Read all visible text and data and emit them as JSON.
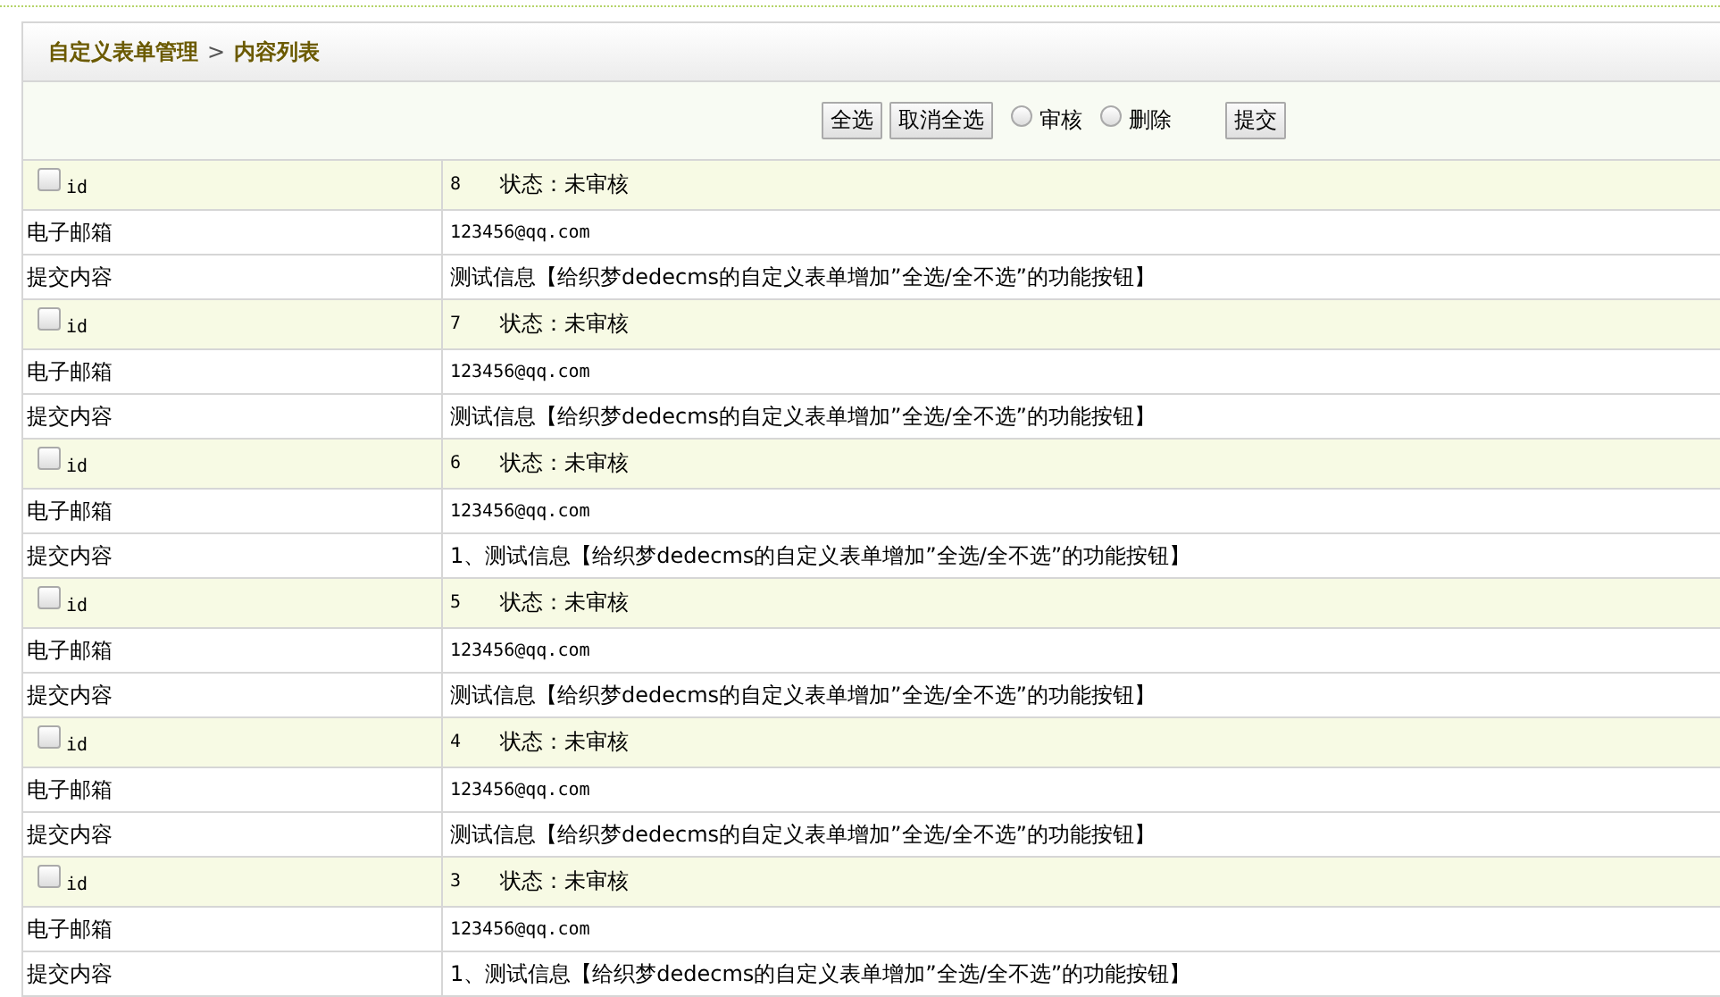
{
  "breadcrumb": {
    "root": "自定义表单管理",
    "separator": ">",
    "current": "内容列表"
  },
  "toolbar": {
    "buttons": [
      "全选",
      "取消全选"
    ],
    "radios": [
      {
        "label": "审核",
        "selected": false
      },
      {
        "label": "删除",
        "selected": false
      }
    ],
    "submit": "提交"
  },
  "records": [
    {
      "id_label": "id",
      "checked": false,
      "id": "8",
      "status": "状态：未审核",
      "fields": [
        {
          "label": "电子邮箱",
          "value": "123456@qq.com",
          "kind": "mono"
        },
        {
          "label": "提交内容",
          "value": "测试信息【给织梦dedecms的自定义表单增加”全选/全不选”的功能按钮】",
          "kind": "text"
        }
      ]
    },
    {
      "id_label": "id",
      "checked": false,
      "id": "7",
      "status": "状态：未审核",
      "fields": [
        {
          "label": "电子邮箱",
          "value": "123456@qq.com",
          "kind": "mono"
        },
        {
          "label": "提交内容",
          "value": "测试信息【给织梦dedecms的自定义表单增加”全选/全不选”的功能按钮】",
          "kind": "text"
        }
      ]
    },
    {
      "id_label": "id",
      "checked": false,
      "id": "6",
      "status": "状态：未审核",
      "fields": [
        {
          "label": "电子邮箱",
          "value": "123456@qq.com",
          "kind": "mono"
        },
        {
          "label": "提交内容",
          "value": "1、测试信息【给织梦dedecms的自定义表单增加”全选/全不选”的功能按钮】",
          "kind": "text"
        }
      ]
    },
    {
      "id_label": "id",
      "checked": false,
      "id": "5",
      "status": "状态：未审核",
      "fields": [
        {
          "label": "电子邮箱",
          "value": "123456@qq.com",
          "kind": "mono"
        },
        {
          "label": "提交内容",
          "value": "测试信息【给织梦dedecms的自定义表单增加”全选/全不选”的功能按钮】",
          "kind": "text"
        }
      ]
    },
    {
      "id_label": "id",
      "checked": false,
      "id": "4",
      "status": "状态：未审核",
      "fields": [
        {
          "label": "电子邮箱",
          "value": "123456@qq.com",
          "kind": "mono"
        },
        {
          "label": "提交内容",
          "value": "测试信息【给织梦dedecms的自定义表单增加”全选/全不选”的功能按钮】",
          "kind": "text"
        }
      ]
    },
    {
      "id_label": "id",
      "checked": false,
      "id": "3",
      "status": "状态：未审核",
      "fields": [
        {
          "label": "电子邮箱",
          "value": "123456@qq.com",
          "kind": "mono"
        },
        {
          "label": "提交内容",
          "value": "1、测试信息【给织梦dedecms的自定义表单增加”全选/全不选”的功能按钮】",
          "kind": "text"
        }
      ]
    }
  ]
}
